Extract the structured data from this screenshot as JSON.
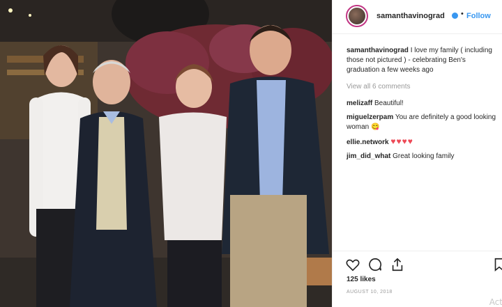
{
  "post": {
    "username": "samanthavinograd",
    "follow_label": "Follow",
    "separator": "•",
    "caption_user": "samanthavinograd",
    "caption_text": "I love my family ( including those not pictured ) - celebrating Ben's graduation a few weeks ago",
    "view_all_comments": "View all 6 comments",
    "comments": [
      {
        "user": "melizaff",
        "text": "Beautiful!"
      },
      {
        "user": "miguelzerpam",
        "text": "You are definitely a good looking woman 😋"
      },
      {
        "user": "ellie.network",
        "text": "♥♥♥♥"
      },
      {
        "user": "jim_did_what",
        "text": "Great looking family"
      }
    ],
    "likes": "125 likes",
    "date": "AUGUST 10, 2018",
    "watermark": "Act"
  },
  "icons": {
    "verified": "verified-badge-icon",
    "like": "heart-icon",
    "comment": "comment-icon",
    "share": "share-icon",
    "save": "bookmark-icon"
  },
  "colors": {
    "link": "#3897f0",
    "heart": "#ed4956",
    "muted": "#999999",
    "text": "#262626"
  }
}
